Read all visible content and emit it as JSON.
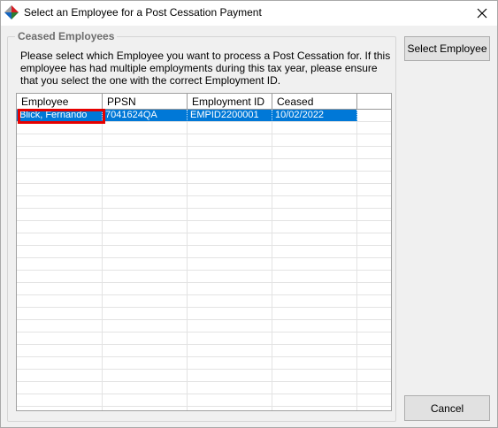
{
  "window": {
    "title": "Select an Employee for a Post Cessation Payment"
  },
  "group": {
    "title": "Ceased Employees",
    "description": "Please select which Employee you want to process a Post Cessation for. If this employee has had multiple employments during this tax year, please ensure that you select the one with the correct Employment ID."
  },
  "grid": {
    "columns": [
      "Employee",
      "PPSN",
      "Employment ID",
      "Ceased"
    ],
    "rows": [
      [
        "Blick, Fernando",
        "7041624QA",
        "EMPID2200001",
        "10/02/2022"
      ]
    ],
    "selected_row": 0
  },
  "buttons": {
    "select": "Select Employee",
    "cancel": "Cancel"
  },
  "colors": {
    "selection": "#0078d7",
    "highlight_box": "#e60000"
  }
}
